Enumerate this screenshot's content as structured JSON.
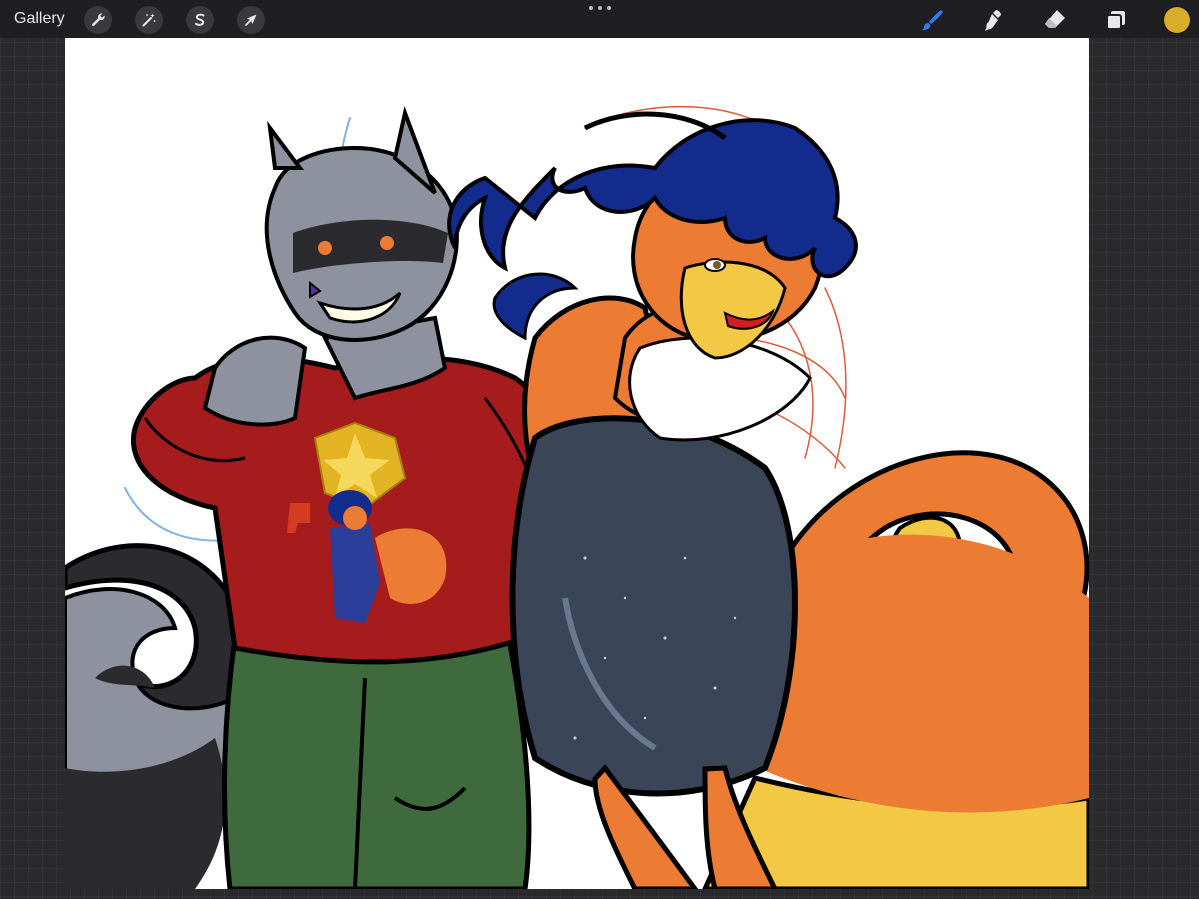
{
  "toolbar": {
    "gallery_label": "Gallery",
    "left_tools": [
      "actions-wrench",
      "adjustments-wand",
      "selection-s",
      "transform-arrow"
    ],
    "right_tools": [
      "brush",
      "smudge",
      "eraser",
      "layers"
    ],
    "current_color": "#d8ad2a",
    "active_tool_color": "#2f7bf6"
  },
  "canvas": {
    "background": "#ffffff",
    "palette": {
      "sweater": "#a61c1c",
      "pants": "#3f6a3e",
      "raccoon_fur": "#8e929f",
      "raccoon_dark": "#2b2b2f",
      "fox_orange": "#ec7b34",
      "fox_yellow": "#f3c845",
      "hair_blue": "#122b8c",
      "dress": "#3a4658",
      "outline": "#000000",
      "sketch_red": "#e0593c",
      "sketch_blue": "#7fb2e6"
    }
  }
}
